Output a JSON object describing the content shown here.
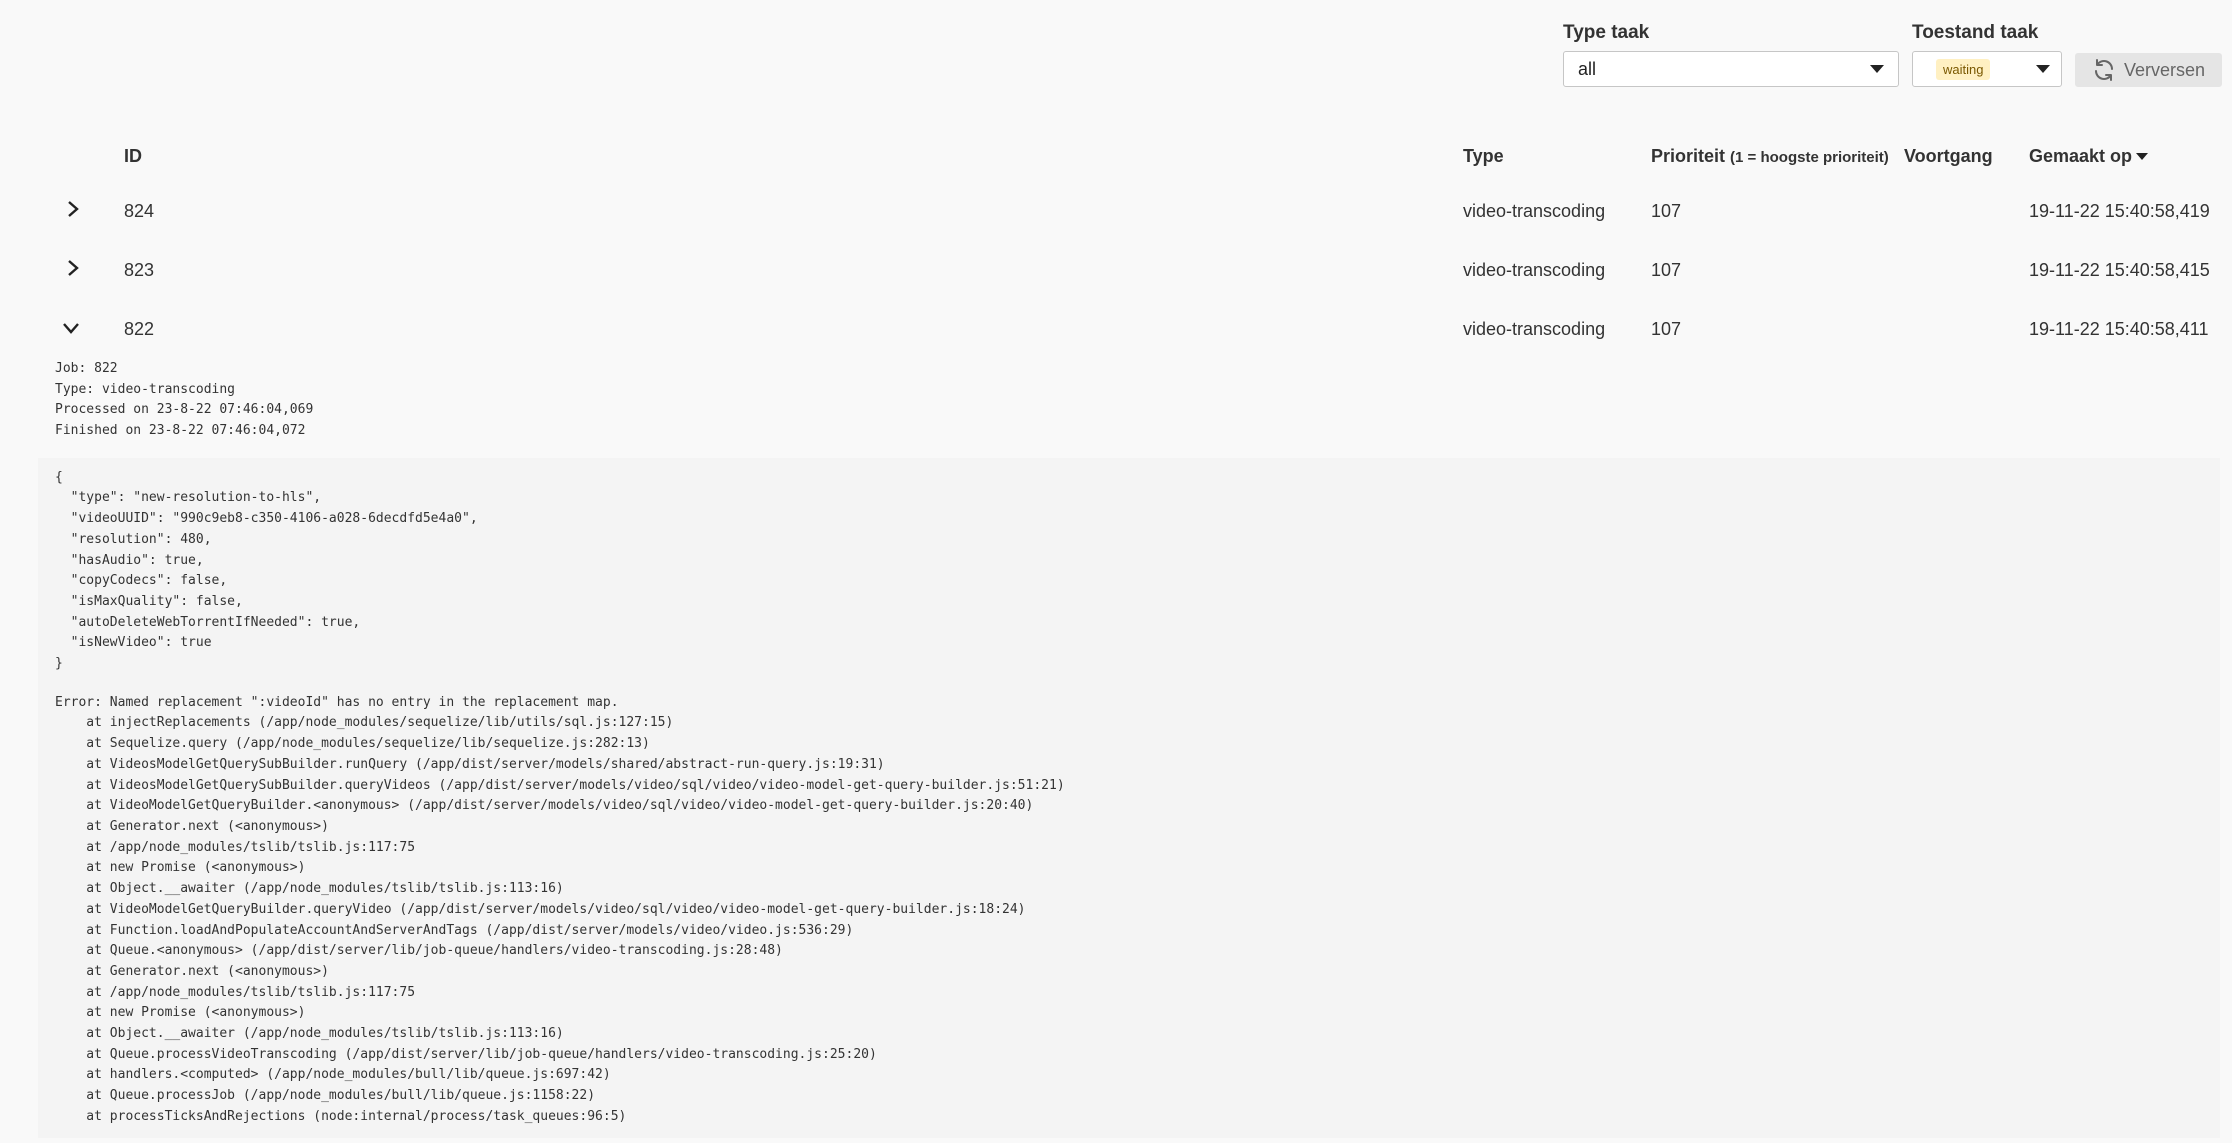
{
  "filters": {
    "job_type": {
      "label": "Type taak",
      "value": "all"
    },
    "job_state": {
      "label": "Toestand taak",
      "value": "waiting"
    },
    "refresh_label": "Verversen"
  },
  "table": {
    "headers": {
      "id": "ID",
      "type": "Type",
      "priority": "Prioriteit",
      "priority_note": "(1 = hoogste prioriteit)",
      "progress": "Voortgang",
      "created": "Gemaakt op"
    },
    "rows": [
      {
        "id": "824",
        "type": "video-transcoding",
        "priority": "107",
        "progress": "",
        "created": "19-11-22 15:40:58,419",
        "expanded": false
      },
      {
        "id": "823",
        "type": "video-transcoding",
        "priority": "107",
        "progress": "",
        "created": "19-11-22 15:40:58,415",
        "expanded": false
      },
      {
        "id": "822",
        "type": "video-transcoding",
        "priority": "107",
        "progress": "",
        "created": "19-11-22 15:40:58,411",
        "expanded": true
      }
    ]
  },
  "detail": {
    "job": "Job: 822",
    "type": "Type: video-transcoding",
    "processed": "Processed on 23-8-22 07:46:04,069",
    "finished": "Finished on 23-8-22 07:46:04,072",
    "json": "{\n  \"type\": \"new-resolution-to-hls\",\n  \"videoUUID\": \"990c9eb8-c350-4106-a028-6decdfd5e4a0\",\n  \"resolution\": 480,\n  \"hasAudio\": true,\n  \"copyCodecs\": false,\n  \"isMaxQuality\": false,\n  \"autoDeleteWebTorrentIfNeeded\": true,\n  \"isNewVideo\": true\n}",
    "error": "Error: Named replacement \":videoId\" has no entry in the replacement map.\n    at injectReplacements (/app/node_modules/sequelize/lib/utils/sql.js:127:15)\n    at Sequelize.query (/app/node_modules/sequelize/lib/sequelize.js:282:13)\n    at VideosModelGetQuerySubBuilder.runQuery (/app/dist/server/models/shared/abstract-run-query.js:19:31)\n    at VideosModelGetQuerySubBuilder.queryVideos (/app/dist/server/models/video/sql/video/video-model-get-query-builder.js:51:21)\n    at VideoModelGetQueryBuilder.<anonymous> (/app/dist/server/models/video/sql/video/video-model-get-query-builder.js:20:40)\n    at Generator.next (<anonymous>)\n    at /app/node_modules/tslib/tslib.js:117:75\n    at new Promise (<anonymous>)\n    at Object.__awaiter (/app/node_modules/tslib/tslib.js:113:16)\n    at VideoModelGetQueryBuilder.queryVideo (/app/dist/server/models/video/sql/video/video-model-get-query-builder.js:18:24)\n    at Function.loadAndPopulateAccountAndServerAndTags (/app/dist/server/models/video/video.js:536:29)\n    at Queue.<anonymous> (/app/dist/server/lib/job-queue/handlers/video-transcoding.js:28:48)\n    at Generator.next (<anonymous>)\n    at /app/node_modules/tslib/tslib.js:117:75\n    at new Promise (<anonymous>)\n    at Object.__awaiter (/app/node_modules/tslib/tslib.js:113:16)\n    at Queue.processVideoTranscoding (/app/dist/server/lib/job-queue/handlers/video-transcoding.js:25:20)\n    at handlers.<computed> (/app/node_modules/bull/lib/queue.js:697:42)\n    at Queue.processJob (/app/node_modules/bull/lib/queue.js:1158:22)\n    at processTicksAndRejections (node:internal/process/task_queues:96:5)"
  },
  "icons": {
    "expand": "chevron-right-icon",
    "collapse": "chevron-down-icon",
    "refresh": "refresh-icon",
    "sort": "sort-desc-icon"
  }
}
